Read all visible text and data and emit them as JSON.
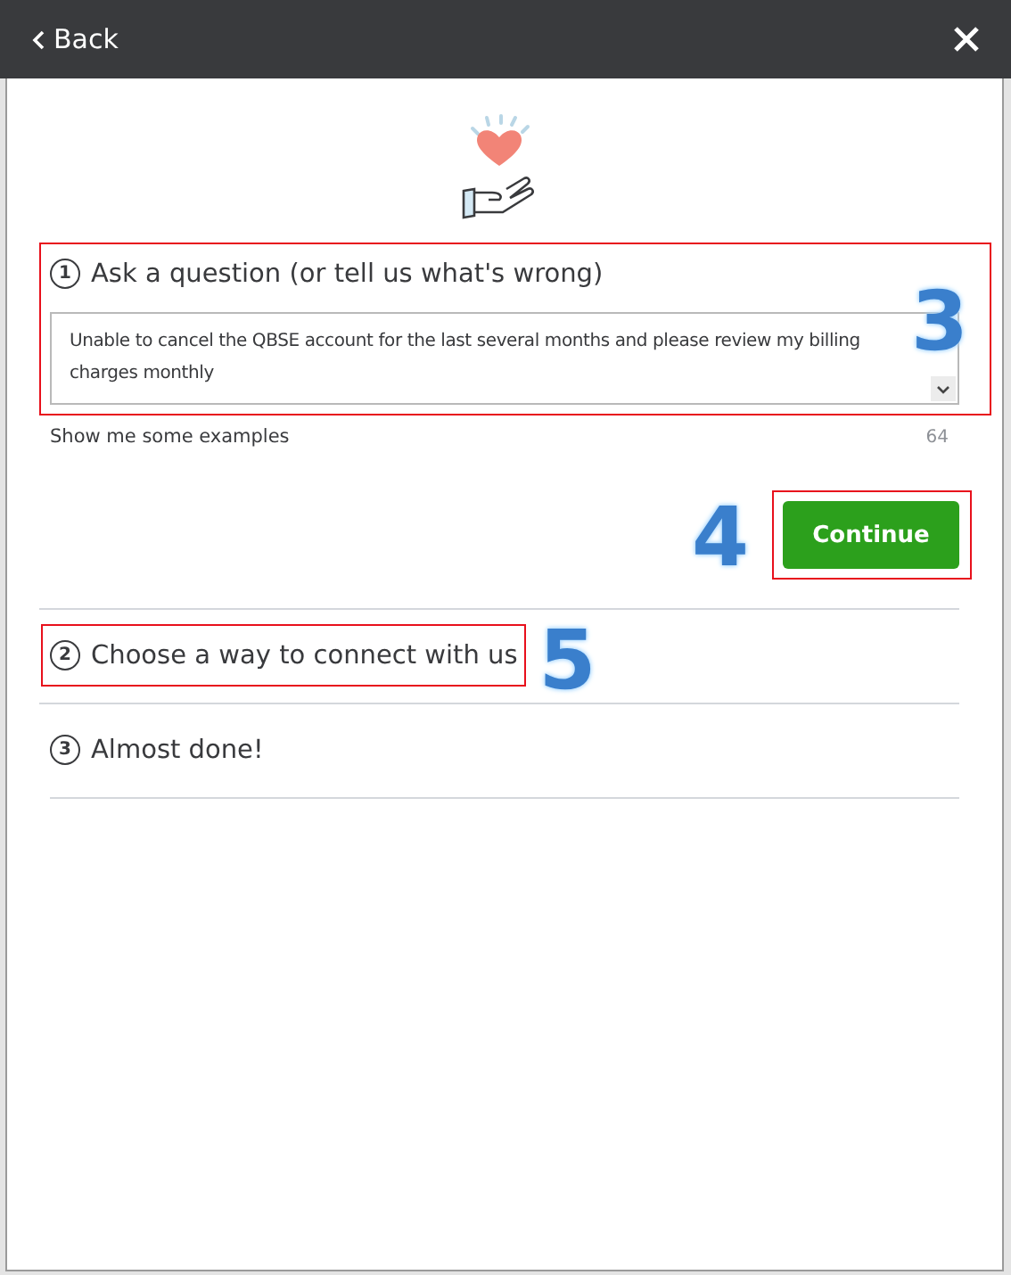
{
  "header": {
    "back_label": "Back"
  },
  "question": {
    "number": "1",
    "title": "Ask a question (or tell us what's wrong)",
    "value": "Unable to cancel the QBSE account for the last several months and please review my billing charges monthly",
    "examples_link": "Show me some examples",
    "count": "64",
    "highlighted": true,
    "callout": "3"
  },
  "continue_button": {
    "label": "Continue",
    "highlighted": true,
    "callout": "4"
  },
  "steps": [
    {
      "number": "2",
      "title": "Choose a way to connect with us",
      "highlighted": true,
      "callout": "5"
    },
    {
      "number": "3",
      "title": "Almost done!",
      "highlighted": false
    }
  ]
}
